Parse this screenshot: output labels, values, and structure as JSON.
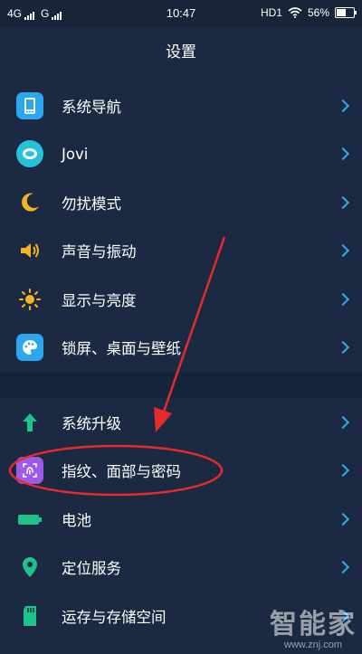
{
  "status_bar": {
    "sim1": "4G",
    "sim2": "G",
    "time": "10:47",
    "hd": "HD1",
    "battery": "56%"
  },
  "header": {
    "title": "设置"
  },
  "settings_group_1": [
    {
      "label": "系统导航",
      "icon": "phone-nav-icon"
    },
    {
      "label": "Jovi",
      "icon": "jovi-icon"
    },
    {
      "label": "勿扰模式",
      "icon": "moon-icon"
    },
    {
      "label": "声音与振动",
      "icon": "speaker-icon"
    },
    {
      "label": "显示与亮度",
      "icon": "sun-icon"
    },
    {
      "label": "锁屏、桌面与壁纸",
      "icon": "palette-icon"
    }
  ],
  "settings_group_2": [
    {
      "label": "系统升级",
      "icon": "arrow-up-icon"
    },
    {
      "label": "指纹、面部与密码",
      "icon": "fingerprint-icon"
    },
    {
      "label": "电池",
      "icon": "battery-icon"
    },
    {
      "label": "定位服务",
      "icon": "location-pin-icon"
    },
    {
      "label": "运存与存储空间",
      "icon": "sd-card-icon"
    }
  ],
  "watermark": {
    "main": "智能家",
    "sub": "www.znj.com"
  },
  "colors": {
    "background": "#1b2a42",
    "chevron": "#29b0e8",
    "annotation": "#e52b2b"
  }
}
